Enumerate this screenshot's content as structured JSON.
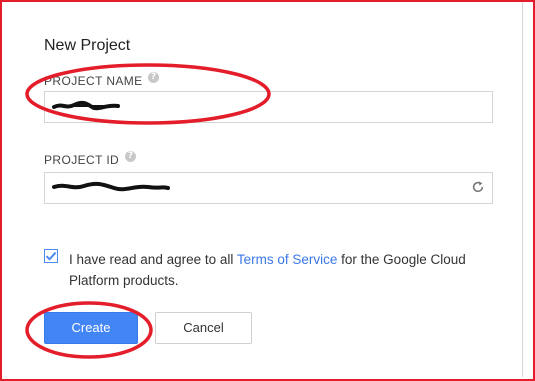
{
  "dialog": {
    "title": "New Project",
    "project_name": {
      "label": "PROJECT NAME",
      "value": ""
    },
    "project_id": {
      "label": "PROJECT ID",
      "value": ""
    },
    "agreement": {
      "checked": true,
      "prefix": "I have read and agree to all ",
      "link": "Terms of Service",
      "suffix": " for the Google Cloud Platform products."
    },
    "buttons": {
      "create": "Create",
      "cancel": "Cancel"
    }
  },
  "colors": {
    "annotation": "#e41d2a",
    "primary": "#4285f4",
    "link": "#3b78e7"
  }
}
